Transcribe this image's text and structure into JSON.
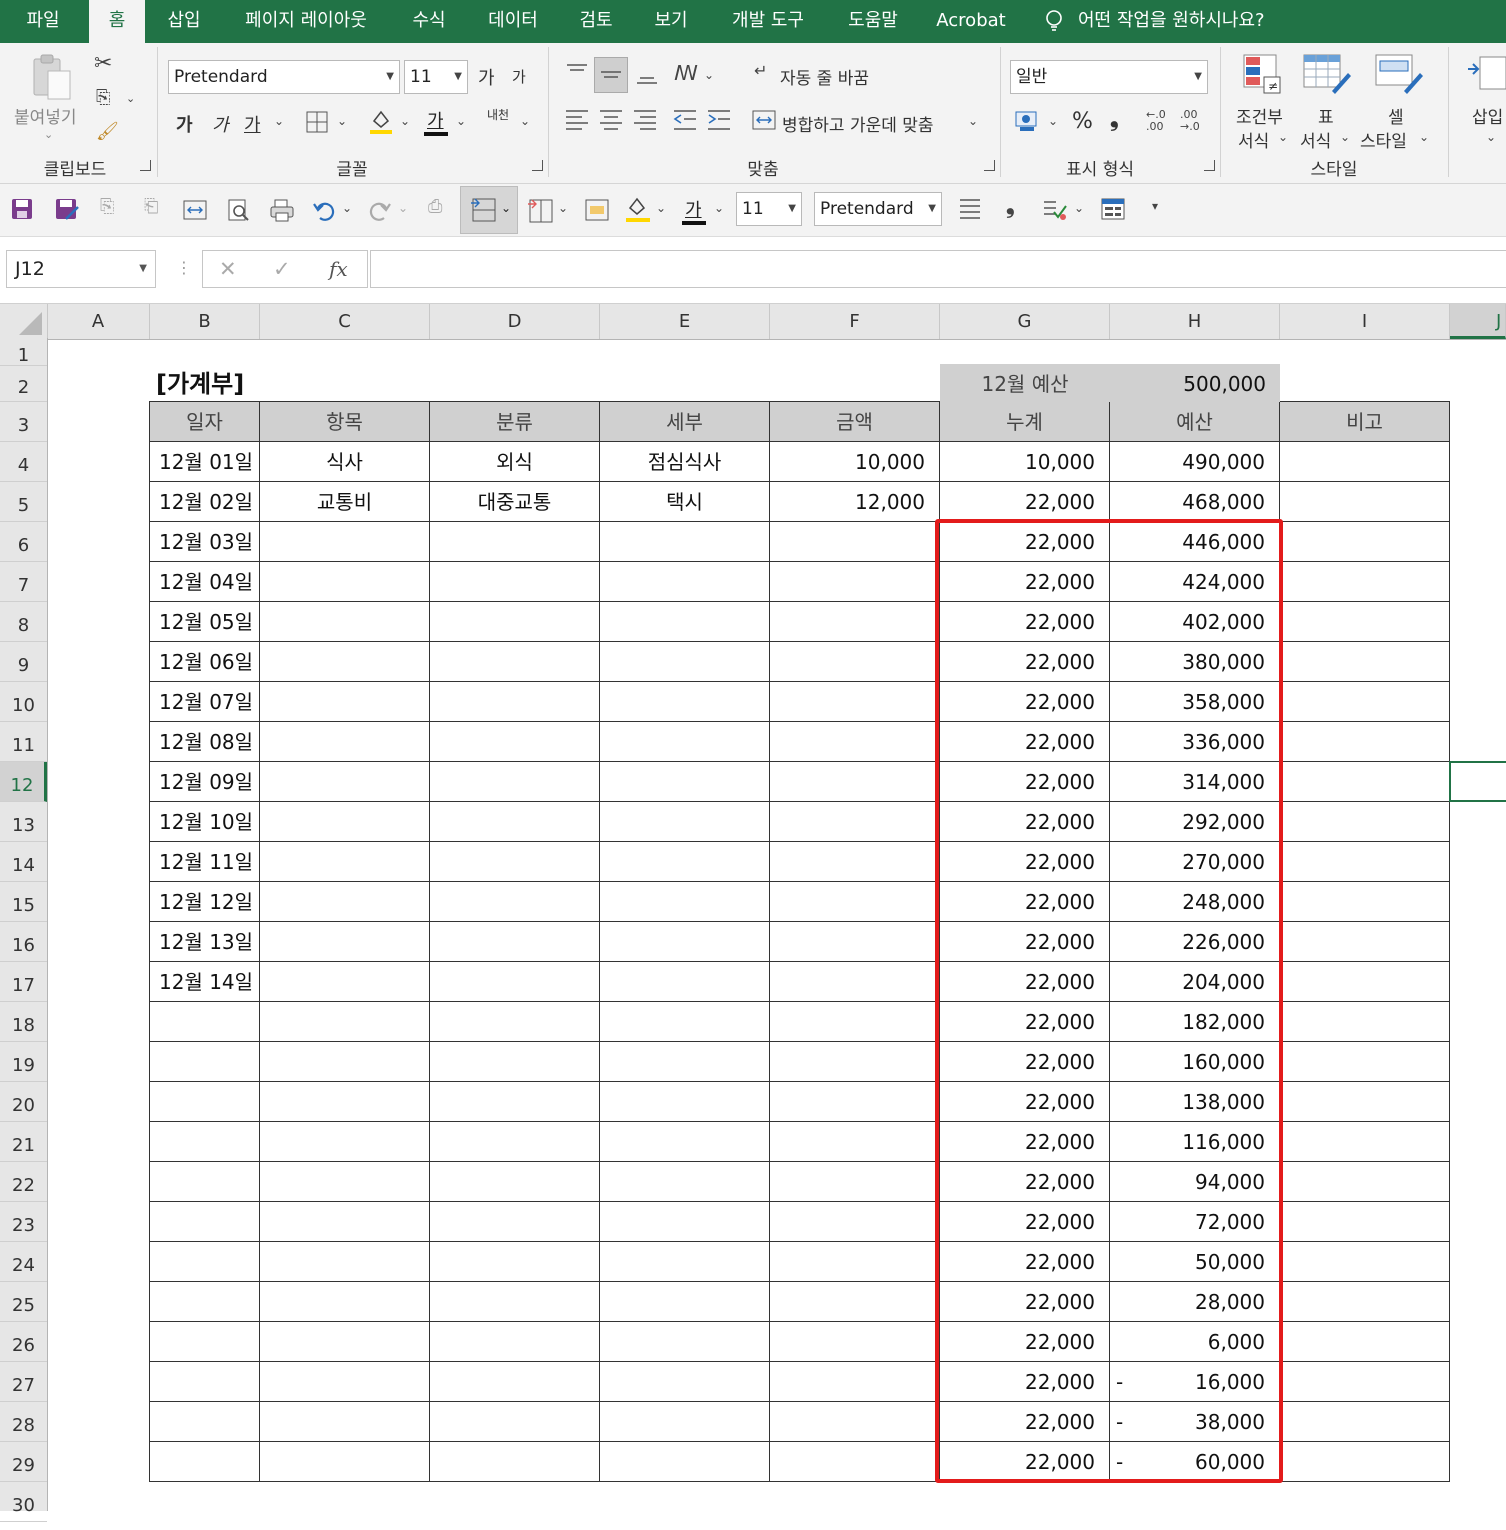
{
  "menu": {
    "tabs": [
      "파일",
      "홈",
      "삽입",
      "페이지 레이아웃",
      "수식",
      "데이터",
      "검토",
      "보기",
      "개발 도구",
      "도움말",
      "Acrobat"
    ],
    "active": "홈",
    "tellme": "어떤 작업을 원하시나요?"
  },
  "ribbon": {
    "clipboard": {
      "paste": "붙여넣기",
      "group": "클립보드"
    },
    "font": {
      "name": "Pretendard",
      "size": "11",
      "group": "글꼴",
      "bold": "가",
      "italic": "가",
      "underline": "가",
      "grow": "가",
      "shrink": "가",
      "color_glyph": "가",
      "phonetic": "내천"
    },
    "align": {
      "wrap": "자동 줄 바꿈",
      "merge": "병합하고 가운데 맞춤",
      "group": "맞춤"
    },
    "number": {
      "format": "일반",
      "group": "표시 형식",
      "percent": "%",
      "comma": "❟"
    },
    "styles": {
      "cond_line1": "조건부",
      "cond_line2": "서식",
      "table_line1": "표",
      "table_line2": "서식",
      "cell_line1": "셀",
      "cell_line2": "스타일",
      "group": "스타일"
    },
    "cells": {
      "insert": "삽입"
    }
  },
  "qat": {
    "font_size": "11",
    "font_name": "Pretendard",
    "color_glyph": "가"
  },
  "formula": {
    "namebox": "J12",
    "fx": "fx",
    "cancel": "✕",
    "enter": "✓",
    "content": ""
  },
  "columns": [
    "A",
    "B",
    "C",
    "D",
    "E",
    "F",
    "G",
    "H",
    "I",
    "J"
  ],
  "selected_column": "J",
  "selected_row": "12",
  "rows": [
    "1",
    "2",
    "3",
    "4",
    "5",
    "6",
    "7",
    "8",
    "9",
    "10",
    "11",
    "12",
    "13",
    "14",
    "15",
    "16",
    "17",
    "18",
    "19",
    "20",
    "21",
    "22",
    "23",
    "24",
    "25",
    "26",
    "27",
    "28",
    "29",
    "30"
  ],
  "sheet": {
    "title": "[가계부]",
    "budget_label": "12월 예산",
    "budget_value": "500,000",
    "headers": [
      "일자",
      "항목",
      "분류",
      "세부",
      "금액",
      "누계",
      "예산",
      "비고"
    ],
    "table": [
      [
        "12월 01일",
        "식사",
        "외식",
        "점심식사",
        "10,000",
        "10,000",
        "",
        "490,000"
      ],
      [
        "12월 02일",
        "교통비",
        "대중교통",
        "택시",
        "12,000",
        "22,000",
        "",
        "468,000"
      ],
      [
        "12월 03일",
        "",
        "",
        "",
        "",
        "22,000",
        "",
        "446,000"
      ],
      [
        "12월 04일",
        "",
        "",
        "",
        "",
        "22,000",
        "",
        "424,000"
      ],
      [
        "12월 05일",
        "",
        "",
        "",
        "",
        "22,000",
        "",
        "402,000"
      ],
      [
        "12월 06일",
        "",
        "",
        "",
        "",
        "22,000",
        "",
        "380,000"
      ],
      [
        "12월 07일",
        "",
        "",
        "",
        "",
        "22,000",
        "",
        "358,000"
      ],
      [
        "12월 08일",
        "",
        "",
        "",
        "",
        "22,000",
        "",
        "336,000"
      ],
      [
        "12월 09일",
        "",
        "",
        "",
        "",
        "22,000",
        "",
        "314,000"
      ],
      [
        "12월 10일",
        "",
        "",
        "",
        "",
        "22,000",
        "",
        "292,000"
      ],
      [
        "12월 11일",
        "",
        "",
        "",
        "",
        "22,000",
        "",
        "270,000"
      ],
      [
        "12월 12일",
        "",
        "",
        "",
        "",
        "22,000",
        "",
        "248,000"
      ],
      [
        "12월 13일",
        "",
        "",
        "",
        "",
        "22,000",
        "",
        "226,000"
      ],
      [
        "12월 14일",
        "",
        "",
        "",
        "",
        "22,000",
        "",
        "204,000"
      ],
      [
        "",
        "",
        "",
        "",
        "",
        "22,000",
        "",
        "182,000"
      ],
      [
        "",
        "",
        "",
        "",
        "",
        "22,000",
        "",
        "160,000"
      ],
      [
        "",
        "",
        "",
        "",
        "",
        "22,000",
        "",
        "138,000"
      ],
      [
        "",
        "",
        "",
        "",
        "",
        "22,000",
        "",
        "116,000"
      ],
      [
        "",
        "",
        "",
        "",
        "",
        "22,000",
        "",
        "94,000"
      ],
      [
        "",
        "",
        "",
        "",
        "",
        "22,000",
        "",
        "72,000"
      ],
      [
        "",
        "",
        "",
        "",
        "",
        "22,000",
        "",
        "50,000"
      ],
      [
        "",
        "",
        "",
        "",
        "",
        "22,000",
        "",
        "28,000"
      ],
      [
        "",
        "",
        "",
        "",
        "",
        "22,000",
        "",
        "6,000"
      ],
      [
        "",
        "",
        "",
        "",
        "",
        "22,000",
        "-",
        "16,000"
      ],
      [
        "",
        "",
        "",
        "",
        "",
        "22,000",
        "-",
        "38,000"
      ],
      [
        "",
        "",
        "",
        "",
        "",
        "22,000",
        "-",
        "60,000"
      ]
    ],
    "highlight_color": "#e31b1b"
  }
}
